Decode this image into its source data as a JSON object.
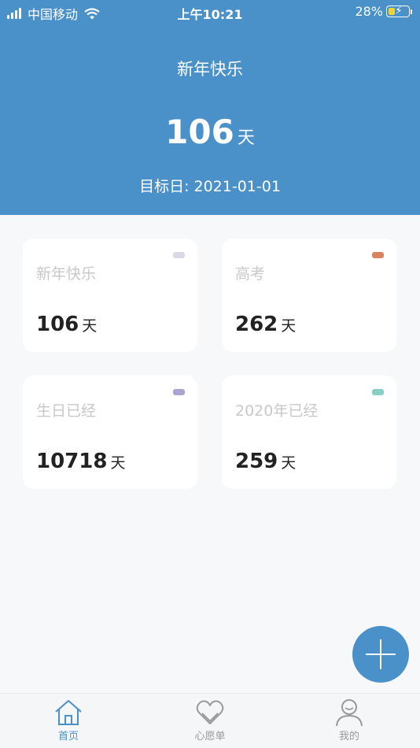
{
  "status_bar": {
    "carrier": "中国移动",
    "time": "上午10:21",
    "battery": "28%"
  },
  "hero": {
    "title": "新年快乐",
    "days": "106",
    "unit": "天",
    "target": "目标日: 2021-01-01"
  },
  "cards": [
    {
      "title": "新年快乐",
      "days": "106",
      "unit": "天",
      "color": "#d9d8e6"
    },
    {
      "title": "高考",
      "days": "262",
      "unit": "天",
      "color": "#d98460"
    },
    {
      "title": "生日已经",
      "days": "10718",
      "unit": "天",
      "color": "#a9a4d2"
    },
    {
      "title": "2020年已经",
      "days": "259",
      "unit": "天",
      "color": "#86cfc2"
    }
  ],
  "tabs": [
    {
      "label": "首页",
      "icon": "home-icon"
    },
    {
      "label": "心愿单",
      "icon": "heart-icon"
    },
    {
      "label": "我的",
      "icon": "user-icon"
    }
  ],
  "colors": {
    "primary": "#4a90c9",
    "background": "#f7f8fa"
  }
}
